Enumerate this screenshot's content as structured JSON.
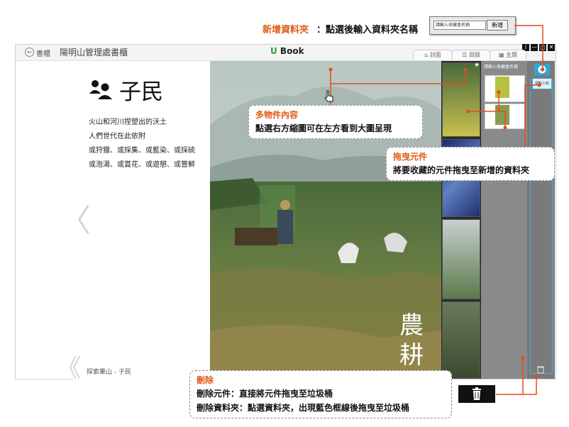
{
  "app": {
    "back_label": "書櫃",
    "book_title": "陽明山管理處書櫃",
    "logo_u": "U",
    "logo_text": " Book",
    "win_buttons": [
      "i",
      "—",
      "□",
      "✕"
    ],
    "tabs": [
      {
        "label": "封面",
        "icon": "home-icon"
      },
      {
        "label": "目錄",
        "icon": "list-icon"
      },
      {
        "label": "主題",
        "icon": "grid-icon"
      }
    ]
  },
  "page": {
    "title": "子民",
    "icon": "people-icon",
    "poem_lines": [
      "火山和河川捏塑出的沃土",
      "人們世代在此依附",
      "或狩獵、或採集、或藍染、或採硫",
      "或泡湯、或賞花、或遊憩、或嘗鮮"
    ],
    "footer": "探索華山 - 子民",
    "photo_caption": [
      "農",
      "耕"
    ]
  },
  "nav": {
    "prev": "〈",
    "next": "〉",
    "first": "《",
    "last": "》"
  },
  "favorites": {
    "header_star": "★",
    "header_text": "請輸入收藏盒名稱",
    "side_folder_label": "請輸入收",
    "add_icon": "plus-icon",
    "trash_icon": "trash-icon"
  },
  "popup": {
    "input_placeholder": "請輸入收藏盒名稱",
    "button_label": "新增"
  },
  "annotations": {
    "new_folder_title": "新增資料夾",
    "new_folder_body": "：點選後輸入資料夾名稱",
    "multi_title": "多物件內容",
    "multi_body": "點選右方縮圖可在左方看到大圖呈現",
    "drag_title": "拖曳元件",
    "drag_body": "將要收藏的元件拖曳至新增的資料夾",
    "delete_title": "刪除",
    "delete_line1": "刪除元件：直接將元件拖曳至垃圾桶",
    "delete_line2": "刪除資料夾：點選資料夾，出現藍色框線後拖曳至垃圾桶"
  },
  "colors": {
    "accent_orange": "#e05a14",
    "folder_blue": "#2ea8d9",
    "logo_green": "#2a9d3c",
    "connector_red": "#e84a1a"
  }
}
